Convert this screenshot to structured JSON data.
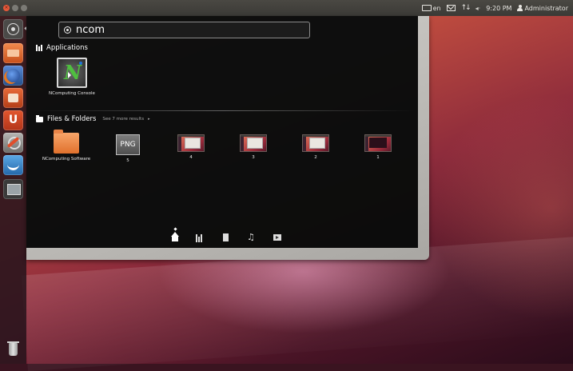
{
  "top_panel": {
    "window_controls": [
      "close-icon",
      "minimize-icon",
      "maximize-icon"
    ],
    "keyboard_layout": "en",
    "clock": "9:20 PM",
    "user": "Administrator",
    "icons": [
      "keyboard-icon",
      "mail-icon",
      "network-icon",
      "volume-icon",
      "user-icon"
    ]
  },
  "launcher": {
    "items": [
      {
        "name": "dash-home-icon"
      },
      {
        "name": "files-icon"
      },
      {
        "name": "firefox-icon"
      },
      {
        "name": "software-center-icon"
      },
      {
        "name": "ubuntu-one-icon",
        "glyph": "U"
      },
      {
        "name": "system-settings-icon"
      },
      {
        "name": "ncomputing-icon"
      },
      {
        "name": "workspace-switcher-icon"
      },
      {
        "name": "trash-icon"
      }
    ]
  },
  "dash": {
    "search": {
      "value": "ncom",
      "placeholder": ""
    },
    "applications": {
      "header": "Applications",
      "results": [
        {
          "label": "NComputing Console",
          "icon": "ncomputing-icon"
        }
      ]
    },
    "files_folders": {
      "header": "Files & Folders",
      "more_results": "See 7 more results",
      "more_arrow": "▸",
      "results": [
        {
          "label": "NComputing Software",
          "icon": "folder-icon"
        },
        {
          "label": "5",
          "icon": "png-icon",
          "badge": "PNG"
        },
        {
          "label": "4",
          "icon": "screenshot-icon"
        },
        {
          "label": "3",
          "icon": "screenshot-icon"
        },
        {
          "label": "2",
          "icon": "screenshot-icon"
        },
        {
          "label": "1",
          "icon": "screenshot-icon"
        }
      ]
    },
    "lenses": [
      "home-lens-icon",
      "applications-lens-icon",
      "files-lens-icon",
      "music-lens-icon",
      "video-lens-icon"
    ]
  },
  "colors": {
    "dash_background": "#000000",
    "panel": "#3b3a36",
    "accent": "#e14e2a"
  }
}
